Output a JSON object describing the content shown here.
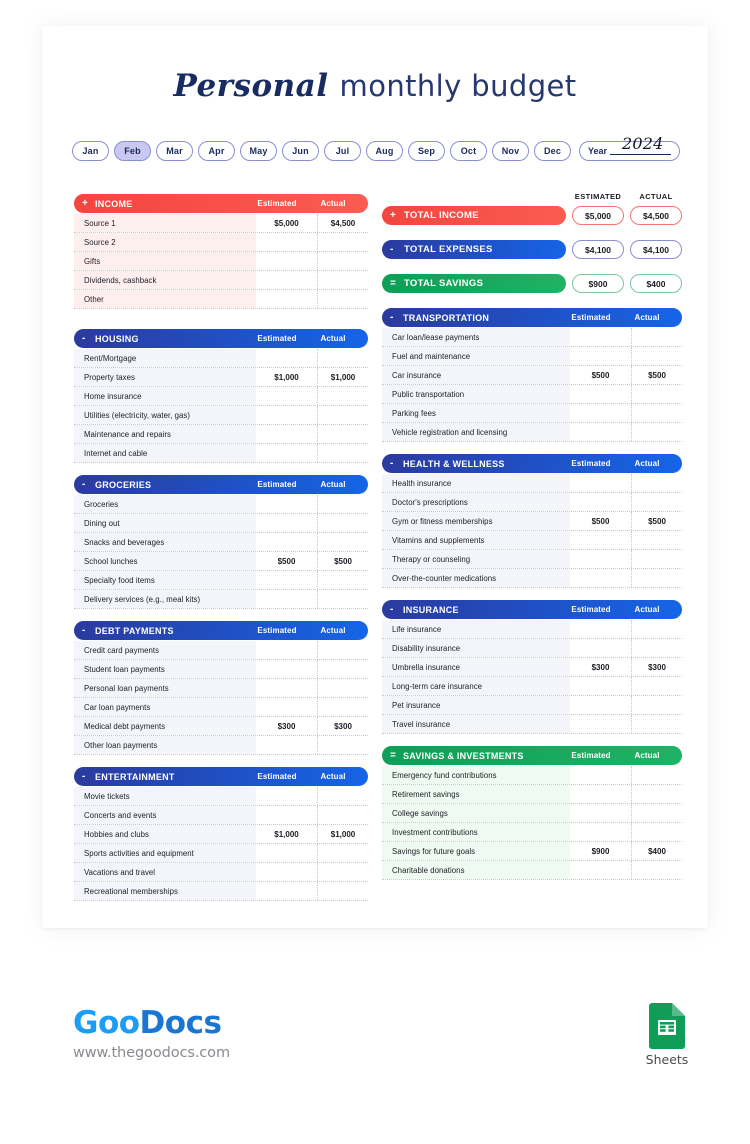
{
  "header": {
    "title_script": "Personal",
    "title_main": "monthly budget"
  },
  "months": {
    "items": [
      {
        "label": "Jan",
        "active": false
      },
      {
        "label": "Feb",
        "active": true
      },
      {
        "label": "Mar",
        "active": false
      },
      {
        "label": "Apr",
        "active": false
      },
      {
        "label": "May",
        "active": false
      },
      {
        "label": "Jun",
        "active": false
      },
      {
        "label": "Jul",
        "active": false
      },
      {
        "label": "Aug",
        "active": false
      },
      {
        "label": "Sep",
        "active": false
      },
      {
        "label": "Oct",
        "active": false
      },
      {
        "label": "Nov",
        "active": false
      },
      {
        "label": "Dec",
        "active": false
      }
    ],
    "year_label": "Year",
    "year_value": "2024"
  },
  "summary": {
    "col_estimated": "ESTIMATED",
    "col_actual": "ACTUAL",
    "rows": [
      {
        "sign": "+",
        "label": "TOTAL INCOME",
        "estimated": "$5,000",
        "actual": "$4,500",
        "color": "#F4453F"
      },
      {
        "sign": "-",
        "label": "TOTAL EXPENSES",
        "estimated": "$4,100",
        "actual": "$4,100",
        "color": "#2B3A9E"
      },
      {
        "sign": "=",
        "label": "TOTAL SAVINGS",
        "estimated": "$900",
        "actual": "$400",
        "color": "#0D9E57"
      }
    ]
  },
  "columns": {
    "estimated": "Estimated",
    "actual": "Actual"
  },
  "sections": {
    "income": {
      "sign": "+",
      "title": "INCOME",
      "accent": "#F4453F",
      "rows": [
        {
          "label": "Source 1",
          "estimated": "$5,000",
          "actual": "$4,500"
        },
        {
          "label": "Source 2",
          "estimated": "",
          "actual": ""
        },
        {
          "label": "Gifts",
          "estimated": "",
          "actual": ""
        },
        {
          "label": "Dividends, cashback",
          "estimated": "",
          "actual": ""
        },
        {
          "label": "Other",
          "estimated": "",
          "actual": ""
        }
      ]
    },
    "housing": {
      "sign": "-",
      "title": "HOUSING",
      "accent": "#2B3A9E",
      "rows": [
        {
          "label": "Rent/Mortgage",
          "estimated": "",
          "actual": ""
        },
        {
          "label": "Property taxes",
          "estimated": "$1,000",
          "actual": "$1,000"
        },
        {
          "label": "Home insurance",
          "estimated": "",
          "actual": ""
        },
        {
          "label": "Utilities (electricity, water, gas)",
          "estimated": "",
          "actual": ""
        },
        {
          "label": "Maintenance and repairs",
          "estimated": "",
          "actual": ""
        },
        {
          "label": "Internet and cable",
          "estimated": "",
          "actual": ""
        }
      ]
    },
    "groceries": {
      "sign": "-",
      "title": "GROCERIES",
      "accent": "#2B3A9E",
      "rows": [
        {
          "label": "Groceries",
          "estimated": "",
          "actual": ""
        },
        {
          "label": "Dining out",
          "estimated": "",
          "actual": ""
        },
        {
          "label": "Snacks and beverages",
          "estimated": "",
          "actual": ""
        },
        {
          "label": "School lunches",
          "estimated": "$500",
          "actual": "$500"
        },
        {
          "label": "Specialty food items",
          "estimated": "",
          "actual": ""
        },
        {
          "label": "Delivery services (e.g., meal kits)",
          "estimated": "",
          "actual": ""
        }
      ]
    },
    "debt_payments": {
      "sign": "-",
      "title": "DEBT PAYMENTS",
      "accent": "#2B3A9E",
      "rows": [
        {
          "label": "Credit card payments",
          "estimated": "",
          "actual": ""
        },
        {
          "label": "Student loan payments",
          "estimated": "",
          "actual": ""
        },
        {
          "label": "Personal loan payments",
          "estimated": "",
          "actual": ""
        },
        {
          "label": "Car loan payments",
          "estimated": "",
          "actual": ""
        },
        {
          "label": "Medical debt payments",
          "estimated": "$300",
          "actual": "$300"
        },
        {
          "label": "Other loan payments",
          "estimated": "",
          "actual": ""
        }
      ]
    },
    "entertainment": {
      "sign": "-",
      "title": "ENTERTAINMENT",
      "accent": "#2B3A9E",
      "rows": [
        {
          "label": "Movie tickets",
          "estimated": "",
          "actual": ""
        },
        {
          "label": "Concerts and events",
          "estimated": "",
          "actual": ""
        },
        {
          "label": "Hobbies and clubs",
          "estimated": "$1,000",
          "actual": "$1,000"
        },
        {
          "label": "Sports activities and equipment",
          "estimated": "",
          "actual": ""
        },
        {
          "label": "Vacations and travel",
          "estimated": "",
          "actual": ""
        },
        {
          "label": "Recreational memberships",
          "estimated": "",
          "actual": ""
        }
      ]
    },
    "transportation": {
      "sign": "-",
      "title": "TRANSPORTATION",
      "accent": "#2B3A9E",
      "rows": [
        {
          "label": "Car loan/lease payments",
          "estimated": "",
          "actual": ""
        },
        {
          "label": "Fuel and maintenance",
          "estimated": "",
          "actual": ""
        },
        {
          "label": "Car insurance",
          "estimated": "$500",
          "actual": "$500"
        },
        {
          "label": "Public transportation",
          "estimated": "",
          "actual": ""
        },
        {
          "label": "Parking fees",
          "estimated": "",
          "actual": ""
        },
        {
          "label": "Vehicle registration and licensing",
          "estimated": "",
          "actual": ""
        }
      ]
    },
    "health_wellness": {
      "sign": "-",
      "title": "HEALTH & WELLNESS",
      "accent": "#2B3A9E",
      "rows": [
        {
          "label": "Health insurance",
          "estimated": "",
          "actual": ""
        },
        {
          "label": "Doctor's prescriptions",
          "estimated": "",
          "actual": ""
        },
        {
          "label": "Gym or fitness memberships",
          "estimated": "$500",
          "actual": "$500"
        },
        {
          "label": "Vitamins and supplements",
          "estimated": "",
          "actual": ""
        },
        {
          "label": "Therapy or counseling",
          "estimated": "",
          "actual": ""
        },
        {
          "label": "Over-the-counter medications",
          "estimated": "",
          "actual": ""
        }
      ]
    },
    "insurance": {
      "sign": "-",
      "title": "INSURANCE",
      "accent": "#2B3A9E",
      "rows": [
        {
          "label": "Life insurance",
          "estimated": "",
          "actual": ""
        },
        {
          "label": "Disability insurance",
          "estimated": "",
          "actual": ""
        },
        {
          "label": "Umbrella insurance",
          "estimated": "$300",
          "actual": "$300"
        },
        {
          "label": "Long-term care insurance",
          "estimated": "",
          "actual": ""
        },
        {
          "label": "Pet insurance",
          "estimated": "",
          "actual": ""
        },
        {
          "label": "Travel insurance",
          "estimated": "",
          "actual": ""
        }
      ]
    },
    "savings_investments": {
      "sign": "=",
      "title": "SAVINGS & INVESTMENTS",
      "accent": "#0D9E57",
      "rows": [
        {
          "label": "Emergency fund contributions",
          "estimated": "",
          "actual": ""
        },
        {
          "label": "Retirement savings",
          "estimated": "",
          "actual": ""
        },
        {
          "label": "College savings",
          "estimated": "",
          "actual": ""
        },
        {
          "label": "Investment contributions",
          "estimated": "",
          "actual": ""
        },
        {
          "label": "Savings for future goals",
          "estimated": "$900",
          "actual": "$400"
        },
        {
          "label": "Charitable donations",
          "estimated": "",
          "actual": ""
        }
      ]
    }
  },
  "footer": {
    "logo_goo": "Goo",
    "logo_docs": "Docs",
    "url": "www.thegoodocs.com",
    "sheets_label": "Sheets"
  }
}
